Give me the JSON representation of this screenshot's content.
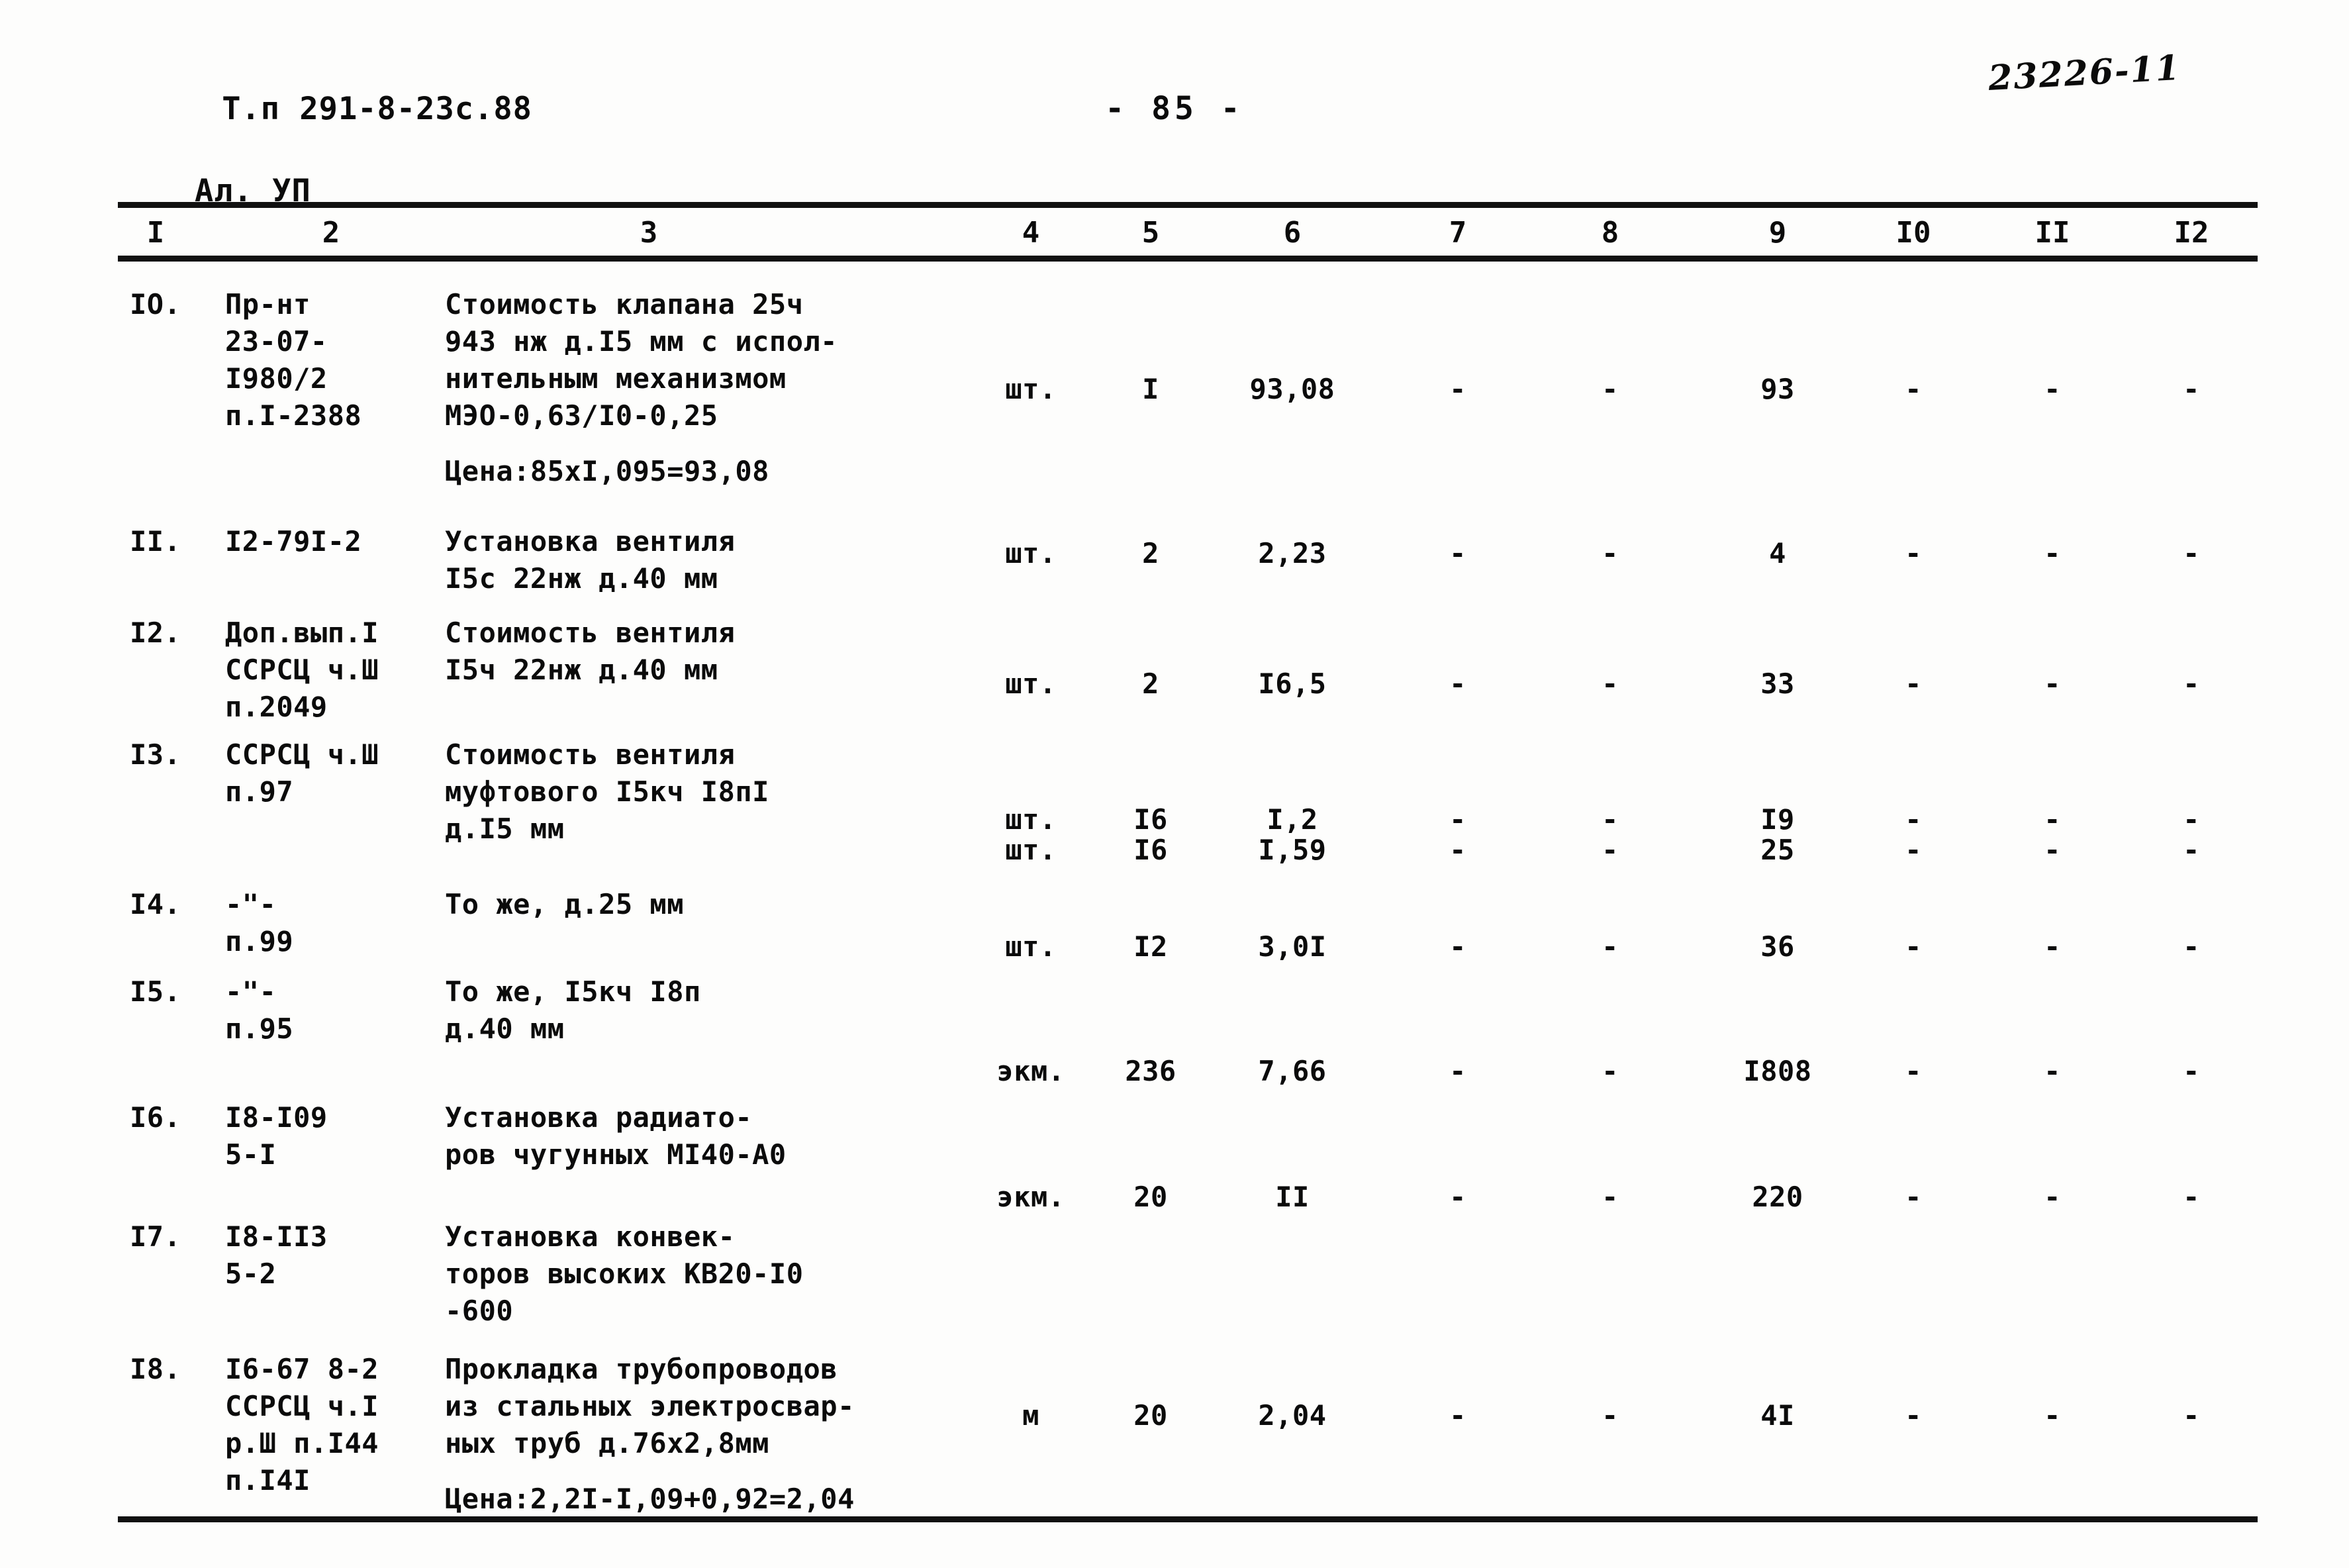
{
  "header": {
    "doc_code_line1": "Т.п 291-8-23с.88",
    "doc_code_line2": "Ал. УП",
    "page_label": "- 85 -",
    "archive_code": "23226-11"
  },
  "table": {
    "column_headers": [
      "I",
      "2",
      "3",
      "4",
      "5",
      "6",
      "7",
      "8",
      "9",
      "I0",
      "II",
      "I2"
    ],
    "dash": "-",
    "rows": [
      {
        "no": "IO.",
        "code_lines": [
          "Пр-нт",
          "23-07-",
          "I980/2",
          "п.I-2388"
        ],
        "desc_lines": [
          "Стоимость клапана 25ч",
          "943 нж д.I5 мм с испол-",
          "нительным механизмом",
          "МЭО-0,63/I0-0,25"
        ],
        "note": "Цена:85хI,095=93,08",
        "unit": "шт.",
        "qty": "I",
        "price": "93,08",
        "col7": "-",
        "col8": "-",
        "total": "93",
        "col10": "-",
        "col11": "-",
        "col12": "-"
      },
      {
        "no": "II.",
        "code_lines": [
          "I2-79I-2"
        ],
        "desc_lines": [
          "Установка вентиля",
          "I5с 22нж д.40 мм"
        ],
        "note": "",
        "unit": "шт.",
        "qty": "2",
        "price": "2,23",
        "col7": "-",
        "col8": "-",
        "total": "4",
        "col10": "-",
        "col11": "-",
        "col12": "-"
      },
      {
        "no": "I2.",
        "code_lines": [
          "Доп.вып.I",
          "ССРСЦ ч.Ш",
          "п.2049"
        ],
        "desc_lines": [
          "Стоимость вентиля",
          "I5ч 22нж д.40 мм"
        ],
        "note": "",
        "unit": "шт.",
        "qty": "2",
        "price": "I6,5",
        "col7": "-",
        "col8": "-",
        "total": "33",
        "col10": "-",
        "col11": "-",
        "col12": "-"
      },
      {
        "no": "I3.",
        "code_lines": [
          "ССРСЦ ч.Ш",
          "п.97"
        ],
        "desc_lines": [
          "Стоимость вентиля",
          "муфтового I5кч I8пI",
          "д.I5 мм"
        ],
        "note": "",
        "unit": "шт.",
        "qty": "I6",
        "price": "I,2",
        "col7": "-",
        "col8": "-",
        "total": "I9",
        "col10": "-",
        "col11": "-",
        "col12": "-"
      },
      {
        "no": "I4.",
        "code_lines": [
          "-\"-",
          "п.99"
        ],
        "desc_lines": [
          "То же, д.25 мм"
        ],
        "note": "",
        "unit": "шт.",
        "qty": "I6",
        "price": "I,59",
        "col7": "-",
        "col8": "-",
        "total": "25",
        "col10": "-",
        "col11": "-",
        "col12": "-"
      },
      {
        "no": "I5.",
        "code_lines": [
          "-\"-",
          "п.95"
        ],
        "desc_lines": [
          "То же, I5кч I8п",
          "д.40 мм"
        ],
        "note": "",
        "unit": "шт.",
        "qty": "I2",
        "price": "3,0I",
        "col7": "-",
        "col8": "-",
        "total": "36",
        "col10": "-",
        "col11": "-",
        "col12": "-"
      },
      {
        "no": "I6.",
        "code_lines": [
          "I8-I09",
          "5-I"
        ],
        "desc_lines": [
          "Установка радиато-",
          "ров чугунных МI40-А0"
        ],
        "note": "",
        "unit": "экм.",
        "qty": "236",
        "price": "7,66",
        "col7": "-",
        "col8": "-",
        "total": "I808",
        "col10": "-",
        "col11": "-",
        "col12": "-"
      },
      {
        "no": "I7.",
        "code_lines": [
          "I8-II3",
          "5-2"
        ],
        "desc_lines": [
          "Установка конвек-",
          "торов высоких КВ20-I0",
          "-600"
        ],
        "note": "",
        "unit": "экм.",
        "qty": "20",
        "price": "II",
        "col7": "-",
        "col8": "-",
        "total": "220",
        "col10": "-",
        "col11": "-",
        "col12": "-"
      },
      {
        "no": "I8.",
        "code_lines": [
          "I6-67 8-2",
          "ССРСЦ ч.I",
          "р.Ш п.I44",
          "п.I4I"
        ],
        "desc_lines": [
          "Прокладка трубопроводов",
          "из стальных электросвар-",
          "ных труб д.76х2,8мм"
        ],
        "note": "Цена:2,2I-I,09+0,92=2,04",
        "unit": "м",
        "qty": "20",
        "price": "2,04",
        "col7": "-",
        "col8": "-",
        "total": "4I",
        "col10": "-",
        "col11": "-",
        "col12": "-"
      }
    ]
  }
}
